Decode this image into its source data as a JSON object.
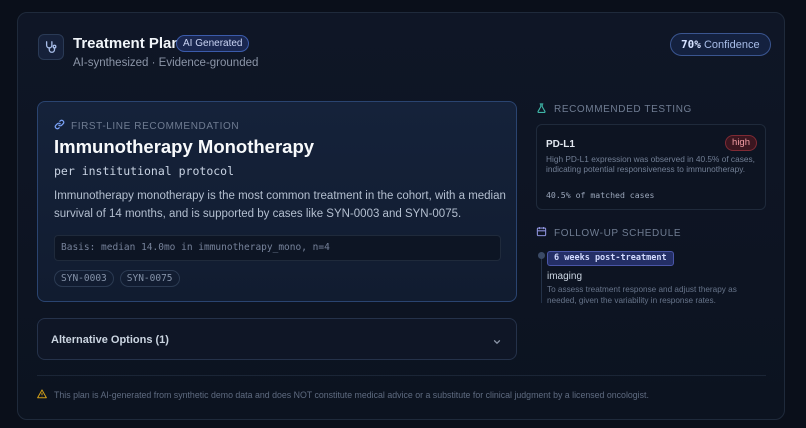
{
  "header": {
    "title": "Treatment Plan",
    "badge": "AI Generated",
    "subtitle": "AI-synthesized · Evidence-grounded",
    "confidence_value": "70%",
    "confidence_label": "Confidence"
  },
  "recommendation": {
    "kicker": "FIRST-LINE RECOMMENDATION",
    "title": "Immunotherapy Monotherapy",
    "subtitle": "per institutional protocol",
    "body": "Immunotherapy monotherapy is the most common treatment in the cohort, with a median survival of 14 months, and is supported by cases like SYN-0003 and SYN-0075.",
    "basis": "Basis: median 14.0mo in immunotherapy_mono, n=4",
    "cases": [
      "SYN-0003",
      "SYN-0075"
    ]
  },
  "alternatives": {
    "label": "Alternative Options (1)"
  },
  "testing": {
    "heading": "RECOMMENDED TESTING",
    "items": [
      {
        "name": "PD-L1",
        "priority": "high",
        "description": "High PD-L1 expression was observed in 40.5% of cases, indicating potential responsiveness to immunotherapy.",
        "match": "40.5% of matched cases"
      }
    ]
  },
  "followup": {
    "heading": "FOLLOW-UP SCHEDULE",
    "items": [
      {
        "when": "6 weeks post-treatment",
        "type": "imaging",
        "description": "To assess treatment response and adjust therapy as needed, given the variability in response rates."
      }
    ]
  },
  "disclaimer": "This plan is AI-generated from synthetic demo data and does NOT constitute medical advice or a substitute for clinical judgment by a licensed oncologist.",
  "colors": {
    "background": "#0a0f1a",
    "accent": "#3b5bab",
    "high_priority": "#f19ba3",
    "warning": "#d4a017"
  }
}
